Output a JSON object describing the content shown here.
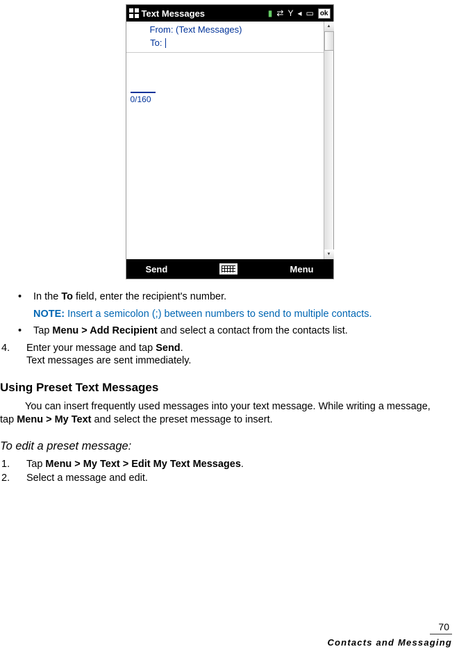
{
  "screenshot": {
    "status_title": "Text Messages",
    "ok_label": "ok",
    "from_label": "From: (Text Messages)",
    "to_label": "To:",
    "counter": "0/160",
    "send_label": "Send",
    "menu_label": "Menu"
  },
  "body": {
    "bullet1_pre": " In the ",
    "bullet1_bold": "To",
    "bullet1_post": " field, enter the recipient's number.",
    "note_label": "NOTE:",
    "note_text": " Insert a semicolon (;) between numbers to send to multiple contacts.",
    "bullet2_pre": "Tap ",
    "bullet2_bold": "Menu > Add Recipient",
    "bullet2_post": " and select a contact from the contacts list.",
    "num4_pre": "Enter your message and tap ",
    "num4_bold": "Send",
    "num4_post": ".",
    "num4_line2": "Text messages are sent immediately.",
    "heading2": "Using Preset Text Messages",
    "para1_pre": "You can insert frequently used messages into your text message. While writing a message, tap ",
    "para1_bold": "Menu > My Text",
    "para1_post": " and select the preset message to insert.",
    "heading3": "To edit a preset message:",
    "edit1_pre": "Tap ",
    "edit1_bold": "Menu > My Text > Edit My Text Messages",
    "edit1_post": ".",
    "edit2": "Select a message and edit."
  },
  "footer": {
    "page": "70",
    "title": "Contacts and Messaging"
  },
  "labels": {
    "bullet": "•",
    "n4": "4.",
    "n1": "1.",
    "n2": "2."
  }
}
